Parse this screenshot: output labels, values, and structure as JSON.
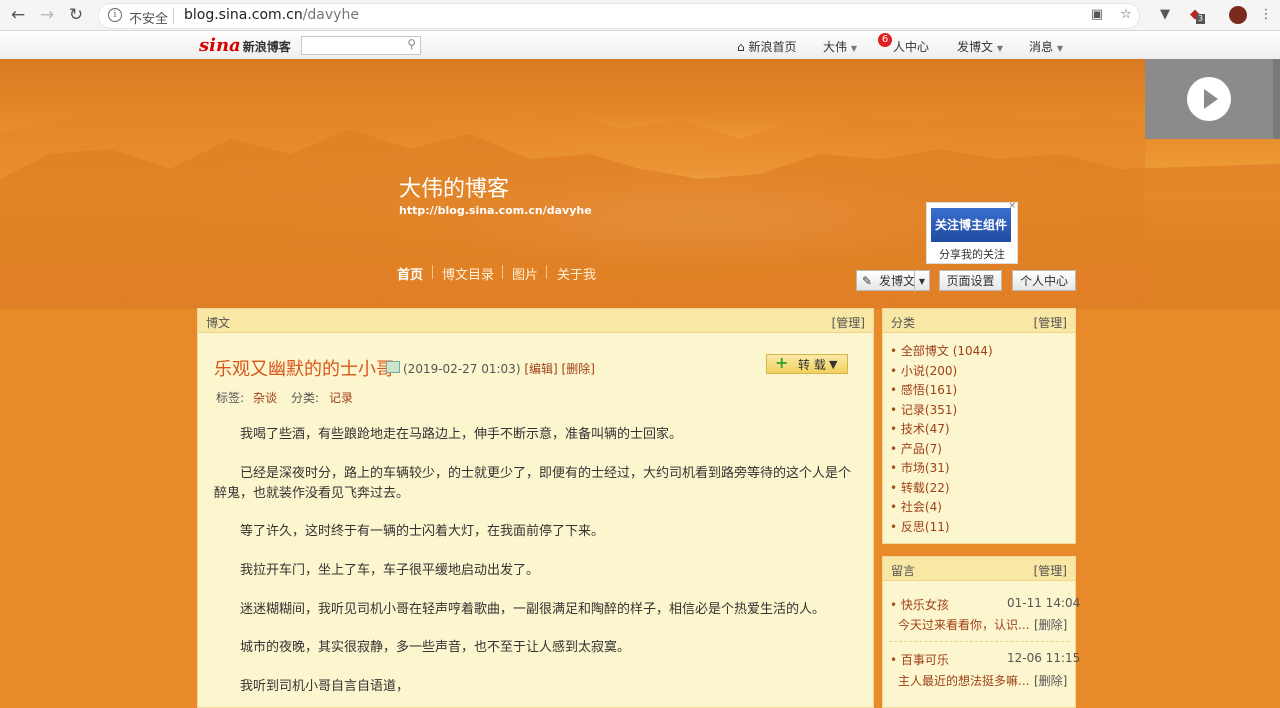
{
  "browser": {
    "security_label": "不安全",
    "url_host": "blog.sina.com.cn",
    "url_path": "/davyhe",
    "ext_badge": "3"
  },
  "toolbar": {
    "logo_text": "新浪博客",
    "logo_mark": "sina",
    "search_placeholder": "",
    "nav_home": "新浪首页",
    "nav_user": "大伟",
    "nav_center": "人中心",
    "nav_center_badge": "6",
    "nav_post": "发博文",
    "nav_msg": "消息"
  },
  "blog": {
    "title": "大伟的博客",
    "url": "http://blog.sina.com.cn/davyhe",
    "nav": [
      "首页",
      "博文目录",
      "图片",
      "关于我"
    ],
    "follow_widget_title": "关注博主组件",
    "follow_widget_caption": "分享我的关注",
    "btn_post": "发博文",
    "btn_page_settings": "页面设置",
    "btn_personal_center": "个人中心"
  },
  "article_panel": {
    "header": "博文",
    "manage": "[管理]",
    "title": "乐观又幽默的的士小哥",
    "date": "(2019-02-27 01:03)",
    "edit": "[编辑]",
    "delete": "[删除]",
    "repost": "转 载",
    "tags_label": "标签:",
    "tag": "杂谈",
    "category_label": "分类:",
    "category": "记录",
    "paragraphs": [
      "我喝了些酒，有些踉跄地走在马路边上，伸手不断示意，准备叫辆的士回家。",
      "已经是深夜时分，路上的车辆较少，的士就更少了，即便有的士经过，大约司机看到路旁等待的这个人是个醉鬼，也就装作没看见飞奔过去。",
      "等了许久，这时终于有一辆的士闪着大灯，在我面前停了下来。",
      "我拉开车门，坐上了车，车子很平缓地启动出发了。",
      "迷迷糊糊间，我听见司机小哥在轻声哼着歌曲，一副很满足和陶醉的样子，相信必是个热爱生活的人。",
      "城市的夜晚，其实很寂静，多一些声音，也不至于让人感到太寂寞。",
      "我听到司机小哥自言自语道，"
    ]
  },
  "category_panel": {
    "header": "分类",
    "manage": "[管理]",
    "items": [
      "全部博文 (1044)",
      "小说(200)",
      "感悟(161)",
      "记录(351)",
      "技术(47)",
      "产品(7)",
      "市场(31)",
      "转载(22)",
      "社会(4)",
      "反思(11)"
    ]
  },
  "message_panel": {
    "header": "留言",
    "manage": "[管理]",
    "items": [
      {
        "name": "快乐女孩",
        "time": "01-11 14:04",
        "text": "今天过来看看你，认识...",
        "delete": "[删除]"
      },
      {
        "name": "百事可乐",
        "time": "12-06 11:15",
        "text": "主人最近的想法挺多嘛...",
        "delete": "[删除]"
      }
    ]
  },
  "colors": {
    "banner_orange": "#e8892a",
    "panel_bg": "#fcf6cf",
    "link": "#a0401a",
    "title_accent": "#d9561b"
  }
}
